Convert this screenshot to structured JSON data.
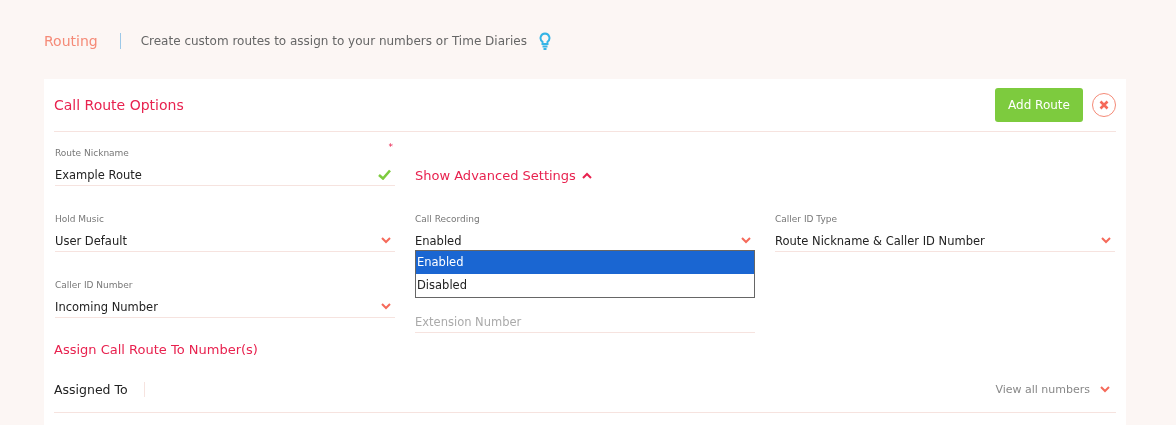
{
  "header": {
    "title": "Routing",
    "description": "Create custom routes to assign to your numbers or Time Diaries"
  },
  "card": {
    "title": "Call Route Options",
    "add_button": "Add Route"
  },
  "nickname": {
    "label": "Route Nickname",
    "required_mark": "*",
    "value": "Example Route",
    "valid": true
  },
  "advanced": {
    "label": "Show Advanced Settings",
    "expanded": true
  },
  "selects": [
    {
      "label": "Hold Music",
      "value": "User Default"
    },
    {
      "label": "Call Recording",
      "value": "Enabled",
      "open": true,
      "options": [
        {
          "label": "Enabled",
          "selected": true
        },
        {
          "label": "Disabled",
          "selected": false
        }
      ]
    },
    {
      "label": "Caller ID Type",
      "value": "Route Nickname & Caller ID Number"
    },
    {
      "label": "Caller ID Number",
      "value": "Incoming Number"
    }
  ],
  "extension": {
    "placeholder": "Extension Number"
  },
  "assign": {
    "title": "Assign Call Route To Number(s)",
    "assigned_label": "Assigned To",
    "view_all": "View all numbers"
  }
}
